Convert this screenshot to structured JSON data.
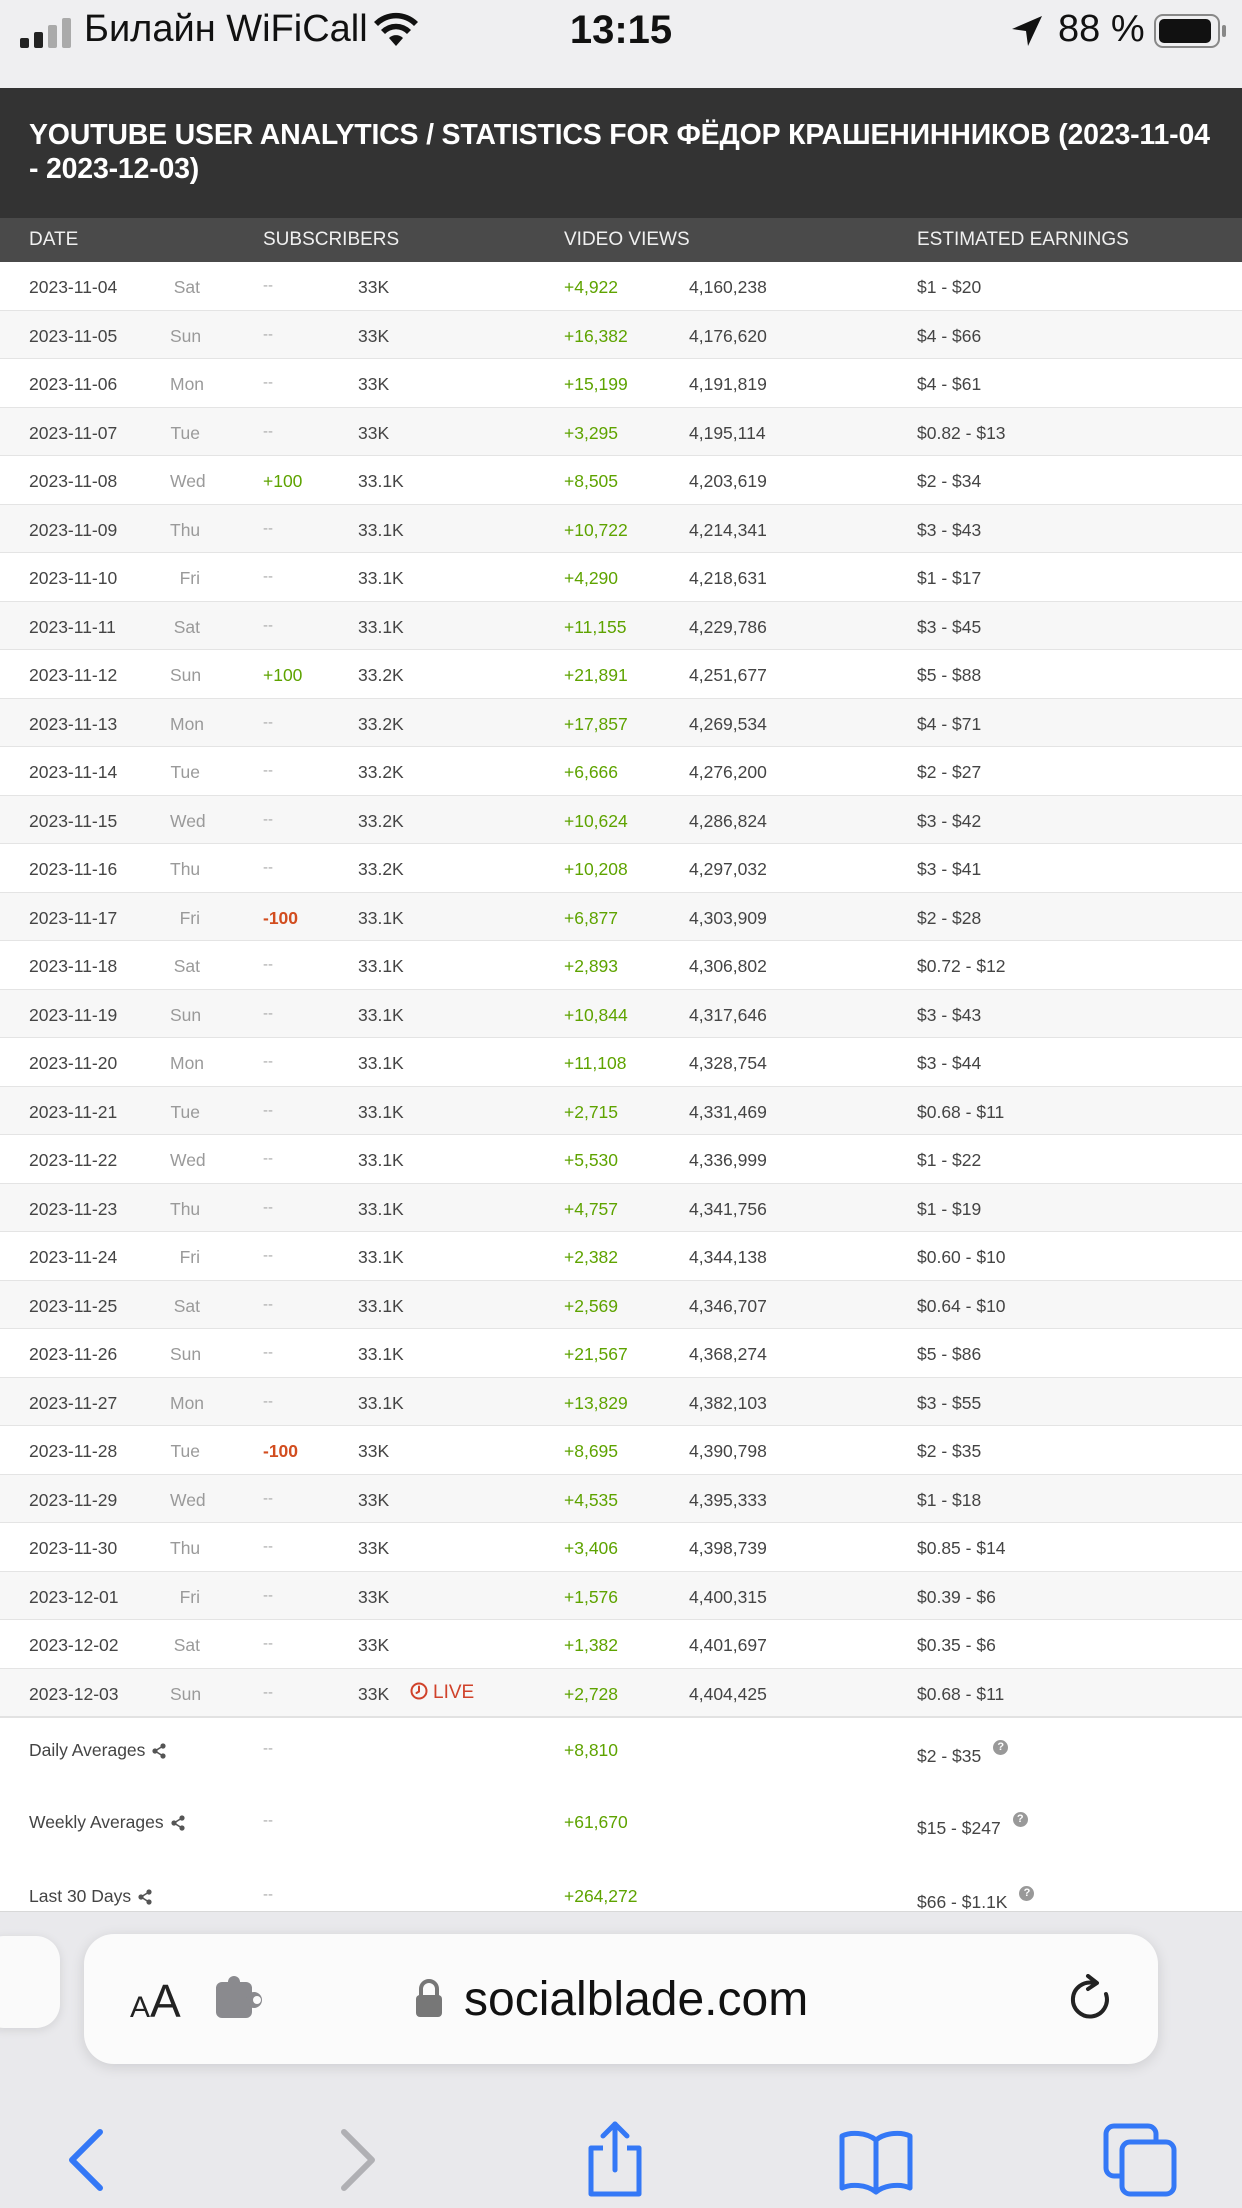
{
  "status_bar": {
    "carrier": "Билайн WiFiCall",
    "time": "13:15",
    "battery": "88 %"
  },
  "header": {
    "title": "YOUTUBE USER ANALYTICS / STATISTICS FOR ФЁДОР КРАШЕНИННИКОВ (2023-11-04 - 2023-12-03)"
  },
  "table": {
    "columns": [
      "DATE",
      "SUBSCRIBERS",
      "VIDEO VIEWS",
      "ESTIMATED EARNINGS"
    ],
    "rows": [
      {
        "date": "2023-11-04",
        "day": "Sat",
        "sub_change": "--",
        "subs": "33K",
        "views_change": "+4,922",
        "views": "4,160,238",
        "earnings": "$1  -  $20"
      },
      {
        "date": "2023-11-05",
        "day": "Sun",
        "sub_change": "--",
        "subs": "33K",
        "views_change": "+16,382",
        "views": "4,176,620",
        "earnings": "$4  -  $66"
      },
      {
        "date": "2023-11-06",
        "day": "Mon",
        "sub_change": "--",
        "subs": "33K",
        "views_change": "+15,199",
        "views": "4,191,819",
        "earnings": "$4  -  $61"
      },
      {
        "date": "2023-11-07",
        "day": "Tue",
        "sub_change": "--",
        "subs": "33K",
        "views_change": "+3,295",
        "views": "4,195,114",
        "earnings": "$0.82  -  $13"
      },
      {
        "date": "2023-11-08",
        "day": "Wed",
        "sub_change": "+100",
        "subs": "33.1K",
        "views_change": "+8,505",
        "views": "4,203,619",
        "earnings": "$2  -  $34"
      },
      {
        "date": "2023-11-09",
        "day": "Thu",
        "sub_change": "--",
        "subs": "33.1K",
        "views_change": "+10,722",
        "views": "4,214,341",
        "earnings": "$3  -  $43"
      },
      {
        "date": "2023-11-10",
        "day": "Fri",
        "sub_change": "--",
        "subs": "33.1K",
        "views_change": "+4,290",
        "views": "4,218,631",
        "earnings": "$1  -  $17"
      },
      {
        "date": "2023-11-11",
        "day": "Sat",
        "sub_change": "--",
        "subs": "33.1K",
        "views_change": "+11,155",
        "views": "4,229,786",
        "earnings": "$3  -  $45"
      },
      {
        "date": "2023-11-12",
        "day": "Sun",
        "sub_change": "+100",
        "subs": "33.2K",
        "views_change": "+21,891",
        "views": "4,251,677",
        "earnings": "$5  -  $88"
      },
      {
        "date": "2023-11-13",
        "day": "Mon",
        "sub_change": "--",
        "subs": "33.2K",
        "views_change": "+17,857",
        "views": "4,269,534",
        "earnings": "$4  -  $71"
      },
      {
        "date": "2023-11-14",
        "day": "Tue",
        "sub_change": "--",
        "subs": "33.2K",
        "views_change": "+6,666",
        "views": "4,276,200",
        "earnings": "$2  -  $27"
      },
      {
        "date": "2023-11-15",
        "day": "Wed",
        "sub_change": "--",
        "subs": "33.2K",
        "views_change": "+10,624",
        "views": "4,286,824",
        "earnings": "$3  -  $42"
      },
      {
        "date": "2023-11-16",
        "day": "Thu",
        "sub_change": "--",
        "subs": "33.2K",
        "views_change": "+10,208",
        "views": "4,297,032",
        "earnings": "$3  -  $41"
      },
      {
        "date": "2023-11-17",
        "day": "Fri",
        "sub_change": "-100",
        "subs": "33.1K",
        "views_change": "+6,877",
        "views": "4,303,909",
        "earnings": "$2  -  $28"
      },
      {
        "date": "2023-11-18",
        "day": "Sat",
        "sub_change": "--",
        "subs": "33.1K",
        "views_change": "+2,893",
        "views": "4,306,802",
        "earnings": "$0.72  -  $12"
      },
      {
        "date": "2023-11-19",
        "day": "Sun",
        "sub_change": "--",
        "subs": "33.1K",
        "views_change": "+10,844",
        "views": "4,317,646",
        "earnings": "$3  -  $43"
      },
      {
        "date": "2023-11-20",
        "day": "Mon",
        "sub_change": "--",
        "subs": "33.1K",
        "views_change": "+11,108",
        "views": "4,328,754",
        "earnings": "$3  -  $44"
      },
      {
        "date": "2023-11-21",
        "day": "Tue",
        "sub_change": "--",
        "subs": "33.1K",
        "views_change": "+2,715",
        "views": "4,331,469",
        "earnings": "$0.68  -  $11"
      },
      {
        "date": "2023-11-22",
        "day": "Wed",
        "sub_change": "--",
        "subs": "33.1K",
        "views_change": "+5,530",
        "views": "4,336,999",
        "earnings": "$1  -  $22"
      },
      {
        "date": "2023-11-23",
        "day": "Thu",
        "sub_change": "--",
        "subs": "33.1K",
        "views_change": "+4,757",
        "views": "4,341,756",
        "earnings": "$1  -  $19"
      },
      {
        "date": "2023-11-24",
        "day": "Fri",
        "sub_change": "--",
        "subs": "33.1K",
        "views_change": "+2,382",
        "views": "4,344,138",
        "earnings": "$0.60  -  $10"
      },
      {
        "date": "2023-11-25",
        "day": "Sat",
        "sub_change": "--",
        "subs": "33.1K",
        "views_change": "+2,569",
        "views": "4,346,707",
        "earnings": "$0.64  -  $10"
      },
      {
        "date": "2023-11-26",
        "day": "Sun",
        "sub_change": "--",
        "subs": "33.1K",
        "views_change": "+21,567",
        "views": "4,368,274",
        "earnings": "$5  -  $86"
      },
      {
        "date": "2023-11-27",
        "day": "Mon",
        "sub_change": "--",
        "subs": "33.1K",
        "views_change": "+13,829",
        "views": "4,382,103",
        "earnings": "$3  -  $55"
      },
      {
        "date": "2023-11-28",
        "day": "Tue",
        "sub_change": "-100",
        "subs": "33K",
        "views_change": "+8,695",
        "views": "4,390,798",
        "earnings": "$2  -  $35"
      },
      {
        "date": "2023-11-29",
        "day": "Wed",
        "sub_change": "--",
        "subs": "33K",
        "views_change": "+4,535",
        "views": "4,395,333",
        "earnings": "$1  -  $18"
      },
      {
        "date": "2023-11-30",
        "day": "Thu",
        "sub_change": "--",
        "subs": "33K",
        "views_change": "+3,406",
        "views": "4,398,739",
        "earnings": "$0.85  -  $14"
      },
      {
        "date": "2023-12-01",
        "day": "Fri",
        "sub_change": "--",
        "subs": "33K",
        "views_change": "+1,576",
        "views": "4,400,315",
        "earnings": "$0.39  -  $6"
      },
      {
        "date": "2023-12-02",
        "day": "Sat",
        "sub_change": "--",
        "subs": "33K",
        "views_change": "+1,382",
        "views": "4,401,697",
        "earnings": "$0.35  -  $6"
      },
      {
        "date": "2023-12-03",
        "day": "Sun",
        "sub_change": "--",
        "subs": "33K",
        "live": "LIVE",
        "views_change": "+2,728",
        "views": "4,404,425",
        "earnings": "$0.68  -  $11"
      }
    ]
  },
  "summary": [
    {
      "label": "Daily Averages",
      "subs": "--",
      "views": "+8,810",
      "earnings": "$2  -  $35"
    },
    {
      "label": "Weekly Averages",
      "subs": "--",
      "views": "+61,670",
      "earnings": "$15  -  $247"
    },
    {
      "label": "Last 30 Days",
      "subs": "--",
      "views": "+264,272",
      "earnings": "$66  -  $1.1K"
    }
  ],
  "browser": {
    "text_size_label": "AA",
    "domain": "socialblade.com"
  },
  "colors": {
    "header_bg": "#333333",
    "table_head_bg": "#4a4a4a",
    "positive": "#5ea300",
    "negative": "#d24d1f",
    "ios_blue": "#3478f6"
  }
}
